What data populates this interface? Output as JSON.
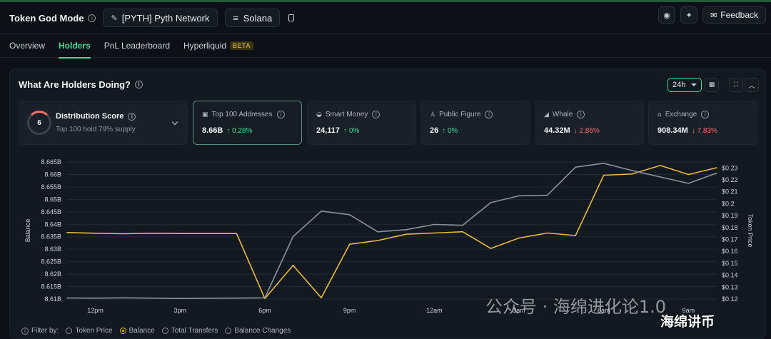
{
  "header": {
    "title": "Token God Mode",
    "token_label": "[PYTH] Pyth Network",
    "chain_label": "Solana",
    "feedback_label": "Feedback"
  },
  "tabs": [
    {
      "label": "Overview",
      "active": false
    },
    {
      "label": "Holders",
      "active": true
    },
    {
      "label": "PnL Leaderboard",
      "active": false
    },
    {
      "label": "Hyperliquid",
      "active": false,
      "badge": "BETA"
    }
  ],
  "panel": {
    "title": "What Are Holders Doing?",
    "time_range": "24h"
  },
  "distribution": {
    "score": "6",
    "title": "Distribution Score",
    "subtitle": "Top 100 hold 79% supply"
  },
  "cards": [
    {
      "label": "Top 100 Addresses",
      "value": "8.66B",
      "change": "↑ 0.28%",
      "direction": "up",
      "icon": "wallet-icon",
      "selected": true
    },
    {
      "label": "Smart Money",
      "value": "24,117",
      "change": "↑ 0%",
      "direction": "up",
      "icon": "brain-icon",
      "selected": false
    },
    {
      "label": "Public Figure",
      "value": "26",
      "change": "↑ 0%",
      "direction": "up",
      "icon": "person-icon",
      "selected": false
    },
    {
      "label": "Whale",
      "value": "44.32M",
      "change": "↓ 2.86%",
      "direction": "down",
      "icon": "whale-icon",
      "selected": false
    },
    {
      "label": "Exchange",
      "value": "908.34M",
      "change": "↓ 7.83%",
      "direction": "down",
      "icon": "bank-icon",
      "selected": false
    }
  ],
  "chart_data": {
    "type": "line",
    "x": [
      "11am",
      "12pm",
      "1pm",
      "2pm",
      "3pm",
      "4pm",
      "5pm",
      "6pm",
      "7pm",
      "8pm",
      "9pm",
      "10pm",
      "11pm",
      "12am",
      "1am",
      "2am",
      "3am",
      "4am",
      "5am",
      "6am",
      "7am",
      "8am",
      "9am",
      "10am"
    ],
    "x_tick_labels": [
      "12pm",
      "3pm",
      "6pm",
      "9pm",
      "12am",
      "3am",
      "6am",
      "9am"
    ],
    "ylabel_left": "Balance",
    "ylabel_right": "Token Price",
    "ylim_left": [
      8.61,
      8.665
    ],
    "ylim_right": [
      0.12,
      0.235
    ],
    "left_ticks": [
      "8.61B",
      "8.615B",
      "8.62B",
      "8.625B",
      "8.63B",
      "8.635B",
      "8.64B",
      "8.645B",
      "8.65B",
      "8.655B",
      "8.66B",
      "8.665B"
    ],
    "right_ticks": [
      "$0.12",
      "$0.13",
      "$0.14",
      "$0.15",
      "$0.16",
      "$0.17",
      "$0.18",
      "$0.19",
      "$0.2",
      "$0.21",
      "$0.22",
      "$0.23"
    ],
    "series": [
      {
        "name": "Balance",
        "axis": "left",
        "color": "#e8b93d",
        "values": [
          8.6367,
          8.6364,
          8.6362,
          8.6364,
          8.6363,
          8.6363,
          8.6363,
          8.6102,
          8.6235,
          8.6105,
          8.632,
          8.6335,
          8.636,
          8.6365,
          8.637,
          8.6303,
          8.6345,
          8.6365,
          8.6355,
          8.6597,
          8.6602,
          8.6636,
          8.66,
          8.6627
        ]
      },
      {
        "name": "Token Price",
        "axis": "right",
        "color": "#8b929b",
        "values": [
          0.1209,
          0.1208,
          0.121,
          0.1208,
          0.1205,
          0.1207,
          0.1208,
          0.121,
          0.1724,
          0.1938,
          0.1908,
          0.1764,
          0.1782,
          0.1826,
          0.1819,
          0.2009,
          0.2066,
          0.2071,
          0.2307,
          0.2339,
          0.2279,
          0.2224,
          0.2171,
          0.2257
        ]
      }
    ]
  },
  "filter": {
    "label": "Filter by:",
    "items": [
      {
        "label": "Token Price",
        "on": false
      },
      {
        "label": "Balance",
        "on": true
      },
      {
        "label": "Total Transfers",
        "on": false
      },
      {
        "label": "Balance Changes",
        "on": false
      }
    ]
  },
  "watermark": {
    "text1": "公众号 · 海绵进化论1.0",
    "text2": "海绵讲币"
  }
}
